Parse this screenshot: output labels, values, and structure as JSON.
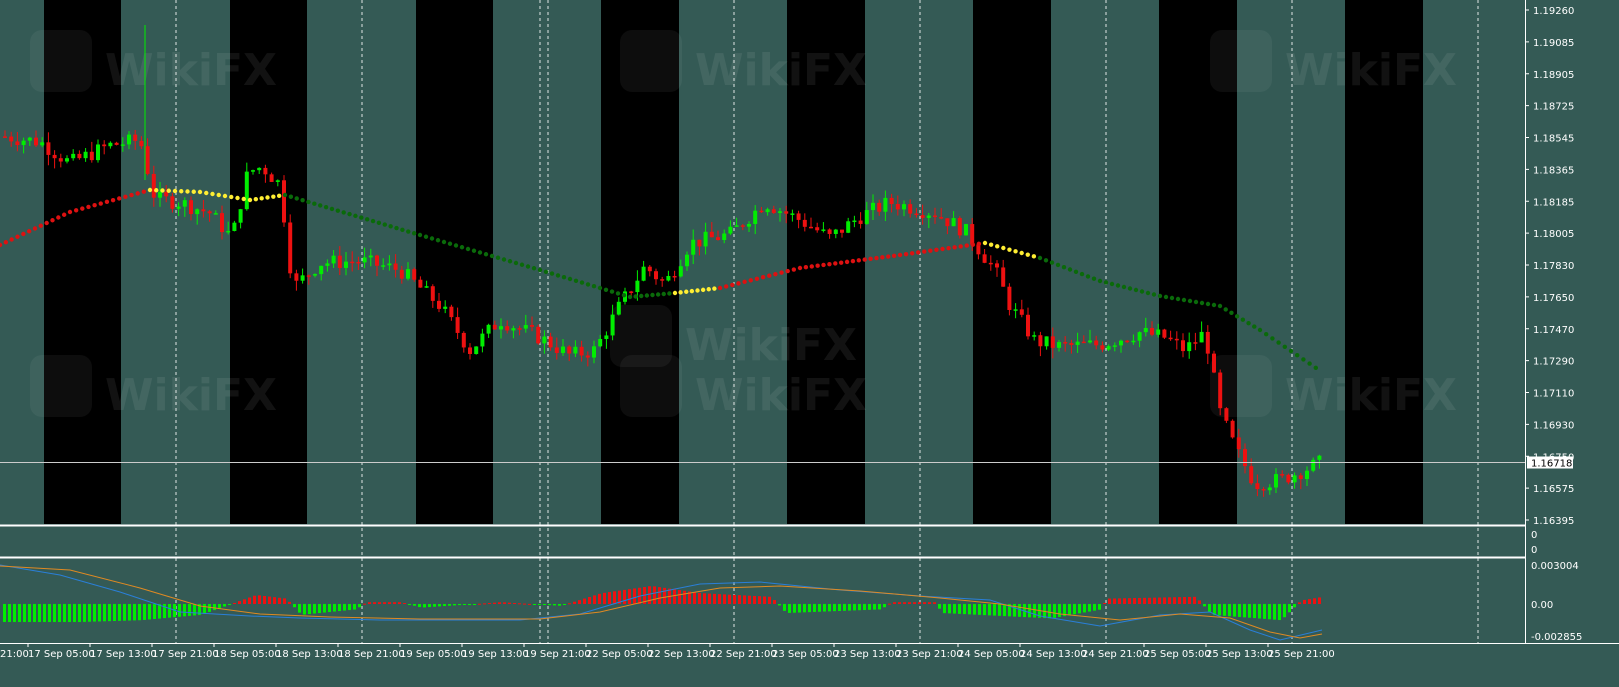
{
  "colors": {
    "background": "#345a55",
    "session_band": "#000000",
    "bull_candle": "#00ee00",
    "bear_candle": "#ee1111",
    "ma_green": "#0a6a0a",
    "ma_yellow": "#ffee33",
    "ma_red": "#dd1111",
    "macd_line": "#2a7fd8",
    "signal_line": "#e08a22",
    "grid_separator": "#ffffff",
    "text": "#ffffff"
  },
  "watermark": {
    "text": "WikiFX",
    "icon": "eagle-logo-icon"
  },
  "price_axis": {
    "labels": [
      "1.19260",
      "1.19085",
      "1.18905",
      "1.18725",
      "1.18545",
      "1.18365",
      "1.18185",
      "1.18005",
      "1.17830",
      "1.17650",
      "1.17470",
      "1.17290",
      "1.17110",
      "1.16930",
      "1.16750",
      "1.16575",
      "1.16395"
    ],
    "current_price": "1.16718"
  },
  "middle_panel": {
    "labels": [
      "0",
      "0"
    ]
  },
  "indicator_panel": {
    "labels": [
      "0.003004",
      "0.00",
      "-0.002855"
    ]
  },
  "time_axis": {
    "labels": [
      "17 Sep 05:00",
      "17 Sep 13:00",
      "17 Sep 21:00",
      "18 Sep 05:00",
      "18 Sep 13:00",
      "18 Sep 21:00",
      "19 Sep 05:00",
      "19 Sep 13:00",
      "19 Sep 21:00",
      "22 Sep 05:00",
      "22 Sep 13:00",
      "22 Sep 21:00",
      "23 Sep 05:00",
      "23 Sep 13:00",
      "23 Sep 21:00",
      "24 Sep 05:00",
      "24 Sep 13:00",
      "24 Sep 21:00",
      "25 Sep 05:00",
      "25 Sep 13:00",
      "25 Sep 21:00"
    ],
    "edge_label": "21:00"
  }
}
